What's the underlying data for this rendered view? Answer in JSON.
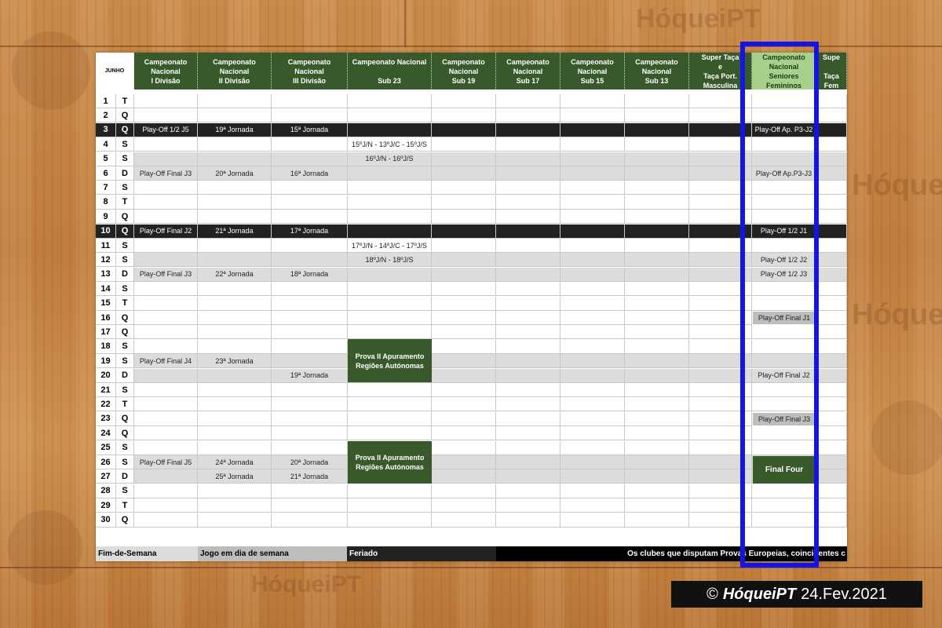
{
  "watermark": "HóqueiPT",
  "month_label": "JUNHO",
  "columns": [
    "Campeonato\nNacional\nI Divisão",
    "Campeonato\nNacional\nII Divisão",
    "Campeonato\nNacional\nIII Divisão",
    "Campeonato Nacional\n\nSub 23",
    "Campeonato\nNacional\nSub 19",
    "Campeonato\nNacional\nSub 17",
    "Campeonato\nNacional\nSub 15",
    "Campeonato\nNacional\nSub 13",
    "Super Taça\ne\nTaça Port.\nMasculina",
    "Campeonato\nNacional\nSeniores\nFemininos",
    "Supe\n\nTaça\nFem"
  ],
  "rows": [
    {
      "d": "1",
      "w": "T",
      "t": "",
      "cells": {}
    },
    {
      "d": "2",
      "w": "Q",
      "t": "",
      "cells": {}
    },
    {
      "d": "3",
      "w": "Q",
      "t": "black",
      "cells": {
        "0": "Play-Off 1/2 J5",
        "1": "19ª Jornada",
        "2": "15ª Jornada",
        "9": "Play-Off Ap. P3-J2"
      }
    },
    {
      "d": "4",
      "w": "S",
      "t": "",
      "cells": {
        "3": "15ºJ/N - 13ºJ/C - 15ºJ/S"
      }
    },
    {
      "d": "5",
      "w": "S",
      "t": "grey",
      "cells": {
        "3": "16ºJ/N -  16ºJ/S"
      }
    },
    {
      "d": "6",
      "w": "D",
      "t": "grey",
      "cells": {
        "0": "Play-Off Final J3",
        "1": "20ª Jornada",
        "2": "16ª Jornada",
        "9": "Play-Off Ap.P3-J3"
      }
    },
    {
      "d": "7",
      "w": "S",
      "t": "",
      "cells": {}
    },
    {
      "d": "8",
      "w": "T",
      "t": "",
      "cells": {}
    },
    {
      "d": "9",
      "w": "Q",
      "t": "",
      "cells": {}
    },
    {
      "d": "10",
      "w": "Q",
      "t": "black",
      "cells": {
        "0": "Play-Off Final J2",
        "1": "21ª Jornada",
        "2": "17ª Jornada",
        "9": "Play-Off 1/2 J1"
      }
    },
    {
      "d": "11",
      "w": "S",
      "t": "",
      "cells": {
        "3": "17ºJ/N - 14ºJ/C - 17ºJ/S"
      }
    },
    {
      "d": "12",
      "w": "S",
      "t": "grey",
      "cells": {
        "3": "18ºJ/N -  18ºJ/S",
        "9": "Play-Off 1/2 J2"
      }
    },
    {
      "d": "13",
      "w": "D",
      "t": "grey",
      "cells": {
        "0": "Play-Off Final J3",
        "1": "22ª Jornada",
        "2": "18ª Jornada",
        "9": "Play-Off 1/2 J3"
      }
    },
    {
      "d": "14",
      "w": "S",
      "t": "",
      "cells": {}
    },
    {
      "d": "15",
      "w": "T",
      "t": "",
      "cells": {}
    },
    {
      "d": "16",
      "w": "Q",
      "t": "",
      "cells": {
        "9": "Play-Off Final J1"
      }
    },
    {
      "d": "17",
      "w": "Q",
      "t": "",
      "cells": {}
    },
    {
      "d": "18",
      "w": "S",
      "t": "",
      "cells": {}
    },
    {
      "d": "19",
      "w": "S",
      "t": "grey",
      "cells": {
        "0": "Play-Off Final J4",
        "1": "23ª Jornada"
      }
    },
    {
      "d": "20",
      "w": "D",
      "t": "grey",
      "cells": {
        "2": "19ª Jornada",
        "9": "Play-Off Final J2"
      }
    },
    {
      "d": "21",
      "w": "S",
      "t": "",
      "cells": {}
    },
    {
      "d": "22",
      "w": "T",
      "t": "",
      "cells": {}
    },
    {
      "d": "23",
      "w": "Q",
      "t": "",
      "cells": {
        "9": "Play-Off Final J3"
      }
    },
    {
      "d": "24",
      "w": "Q",
      "t": "",
      "cells": {}
    },
    {
      "d": "25",
      "w": "S",
      "t": "",
      "cells": {}
    },
    {
      "d": "26",
      "w": "S",
      "t": "grey",
      "cells": {
        "0": "Play-Off Final J5",
        "1": "24ª Jornada",
        "2": "20ª Jornada"
      }
    },
    {
      "d": "27",
      "w": "D",
      "t": "grey",
      "cells": {
        "1": "25ª Jornada",
        "2": "21ª Jornada"
      }
    },
    {
      "d": "28",
      "w": "S",
      "t": "",
      "cells": {}
    },
    {
      "d": "29",
      "w": "T",
      "t": "",
      "cells": {}
    },
    {
      "d": "30",
      "w": "Q",
      "t": "",
      "cells": {}
    }
  ],
  "blocks": {
    "prova1": "Prova II Apuramento\nRegiões Autónomas",
    "prova2": "Prova II Apuramento\nRegiões Autónomas",
    "final_four": "Final Four"
  },
  "legend": {
    "weekend": "Fim-de-Semana",
    "weekday": "Jogo em dia de semana",
    "holiday": "Feriado",
    "note": "Os clubes  que disputam Provas Europeias, coincidentes c"
  },
  "credit": {
    "symbol": "©",
    "brand": "HóqueiPT",
    "date": "24.Fev.2021"
  },
  "colors": {
    "header_green": "#385a2b",
    "highlight_blue": "#1414e6",
    "weekend_grey": "#dcdcdc",
    "weekday_black": "#222222"
  }
}
